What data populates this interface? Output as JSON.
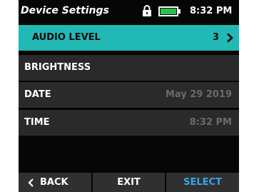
{
  "status_bar": {
    "title": "Device Settings",
    "time": "8:32 PM",
    "lock_icon": "lock-icon",
    "battery_icon": "battery-icon",
    "battery_color": "#2dbf4a"
  },
  "menu": {
    "items": [
      {
        "label": "AUDIO LEVEL",
        "value": "3",
        "selected": true
      },
      {
        "label": "BRIGHTNESS",
        "value": "",
        "selected": false
      },
      {
        "label": "DATE",
        "value": "May 29 2019",
        "selected": false
      },
      {
        "label": "TIME",
        "value": "8:32 PM",
        "selected": false
      }
    ],
    "selected_color": "#22b9b5"
  },
  "softkeys": {
    "back_label": "BACK",
    "exit_label": "EXIT",
    "select_label": "SELECT",
    "select_color": "#3aa5ea"
  }
}
